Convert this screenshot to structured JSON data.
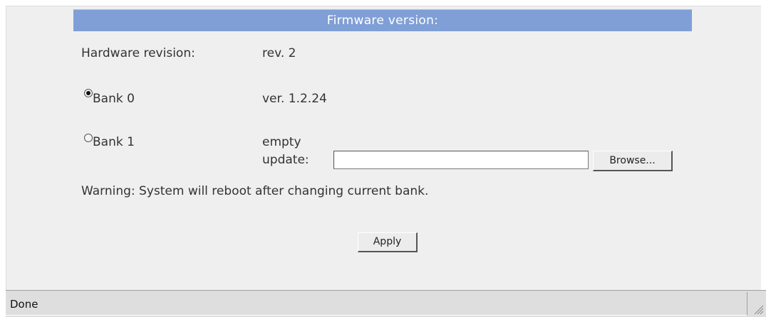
{
  "header": {
    "title": "Firmware version:"
  },
  "hardware": {
    "label": "Hardware revision:",
    "value": "rev. 2"
  },
  "bank0": {
    "label": "Bank 0",
    "value": "ver. 1.2.24",
    "selected": true
  },
  "bank1": {
    "label": "Bank 1",
    "value": "empty",
    "update_label": "update:",
    "file_value": "",
    "browse_label": "Browse...",
    "selected": false
  },
  "warning": "Warning: System will reboot after changing current bank.",
  "apply_label": "Apply",
  "status": {
    "text": "Done"
  },
  "colors": {
    "header_bg": "#7f9fd6",
    "panel_bg": "#efefef",
    "statusbar_bg": "#dedede"
  }
}
